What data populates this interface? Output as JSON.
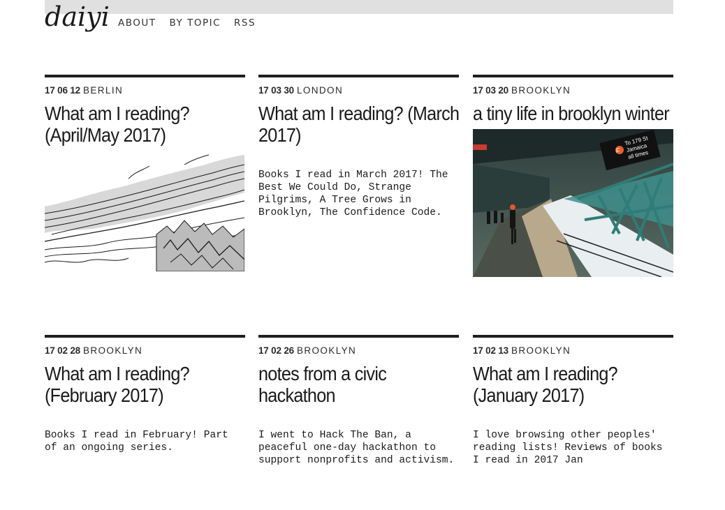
{
  "site": {
    "logo": "daiyi"
  },
  "nav": {
    "items": [
      "ABOUT",
      "BY TOPIC",
      "RSS"
    ]
  },
  "posts": [
    {
      "date": "17 06 12",
      "location": "BERLIN",
      "title": "What am I reading? (April/May 2017)",
      "excerpt": "",
      "image": "mountain-line-drawing"
    },
    {
      "date": "17 03 30",
      "location": "LONDON",
      "title": "What am I reading? (March 2017)",
      "excerpt": "Books I read in March 2017! The Best We Could Do, Strange Pilgrims, A Tree Grows in Brooklyn, The Confidence Code.",
      "image": ""
    },
    {
      "date": "17 03 20",
      "location": "BROOKLYN",
      "title": "a tiny life in brooklyn winter",
      "excerpt": "",
      "image": "elevated-subway-platform-photo"
    },
    {
      "date": "17 02 28",
      "location": "BROOKLYN",
      "title": "What am I reading? (February 2017)",
      "excerpt": "Books I read in February! Part of an ongoing series.",
      "image": ""
    },
    {
      "date": "17 02 26",
      "location": "BROOKLYN",
      "title": "notes from a civic hackathon",
      "excerpt": "I went to Hack The Ban, a peaceful one-day hackathon to support nonprofits and activism.",
      "image": ""
    },
    {
      "date": "17 02 13",
      "location": "BROOKLYN",
      "title": "What am I reading? (January 2017)",
      "excerpt": "I love browsing other peoples' reading lists! Reviews of books I read in 2017 Jan",
      "image": ""
    }
  ],
  "photo_sign": {
    "line1": "To 179 St",
    "line2": "Jamaica",
    "line3": "all times",
    "badge": "F"
  }
}
